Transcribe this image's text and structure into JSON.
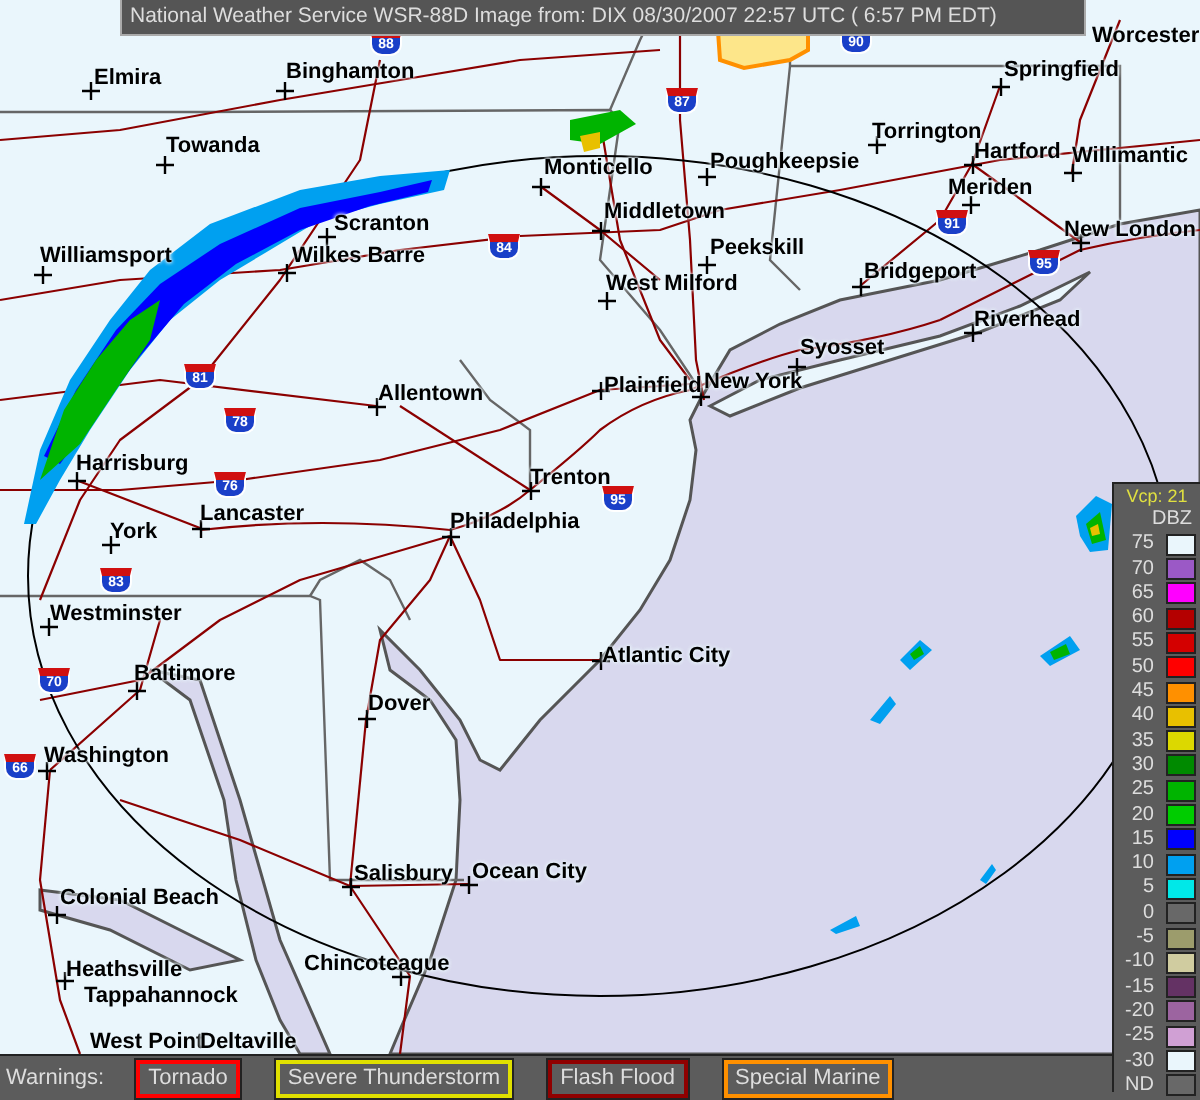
{
  "title": "National Weather Service WSR-88D Image from: DIX 08/30/2007 22:57 UTC ( 6:57 PM EDT)",
  "map": {
    "cities": [
      "Elmira",
      "Binghamton",
      "Towanda",
      "Williamsport",
      "Scranton",
      "Wilkes Barre",
      "Monticello",
      "Poughkeepsie",
      "Middletown",
      "Peekskill",
      "West Milford",
      "Torrington",
      "Hartford",
      "Willimantic",
      "Springfield",
      "Worcester",
      "Meriden",
      "New London",
      "Bridgeport",
      "Riverhead",
      "Syosset",
      "New York",
      "Plainfield",
      "Allentown",
      "Harrisburg",
      "Lancaster",
      "York",
      "Trenton",
      "Philadelphia",
      "Westminster",
      "Baltimore",
      "Washington",
      "Dover",
      "Atlantic City",
      "Salisbury",
      "Ocean City",
      "Colonial Beach",
      "Heathsville",
      "Tappahannock",
      "Chincoteague",
      "West Point",
      "Deltaville"
    ],
    "interstates": [
      "88",
      "90",
      "87",
      "84",
      "81",
      "78",
      "76",
      "83",
      "70",
      "66",
      "95",
      "91",
      "95"
    ]
  },
  "legend": {
    "vcp": "Vcp: 21",
    "unit": "DBZ",
    "entries": [
      {
        "label": "75",
        "color": "#eaf6fc"
      },
      {
        "label": "70",
        "color": "#9b59c6"
      },
      {
        "label": "65",
        "color": "#ff00ff"
      },
      {
        "label": "60",
        "color": "#b40000"
      },
      {
        "label": "55",
        "color": "#d40000"
      },
      {
        "label": "50",
        "color": "#ff0000"
      },
      {
        "label": "45",
        "color": "#ff9000"
      },
      {
        "label": "40",
        "color": "#e8c000"
      },
      {
        "label": "35",
        "color": "#dcd800"
      },
      {
        "label": "30",
        "color": "#008a00"
      },
      {
        "label": "25",
        "color": "#00b400"
      },
      {
        "label": "20",
        "color": "#00cc00"
      },
      {
        "label": "15",
        "color": "#0000ff"
      },
      {
        "label": "10",
        "color": "#00a0f0"
      },
      {
        "label": "5",
        "color": "#00e8e8"
      },
      {
        "label": "0",
        "color": "#686868"
      },
      {
        "label": "-5",
        "color": "#9c9c6c"
      },
      {
        "label": "-10",
        "color": "#d0cca0"
      },
      {
        "label": "-15",
        "color": "#643264"
      },
      {
        "label": "-20",
        "color": "#9c64a0"
      },
      {
        "label": "-25",
        "color": "#d0a0d4"
      },
      {
        "label": "-30",
        "color": "#eaf6fc"
      },
      {
        "label": "ND",
        "color": "#686868"
      }
    ]
  },
  "warnings": {
    "label": "Warnings:",
    "items": [
      {
        "label": "Tornado",
        "color": "#ff0000"
      },
      {
        "label": "Severe Thunderstorm",
        "color": "#e0e000"
      },
      {
        "label": "Flash Flood",
        "color": "#900000"
      },
      {
        "label": "Special Marine",
        "color": "#ff9000"
      }
    ]
  }
}
